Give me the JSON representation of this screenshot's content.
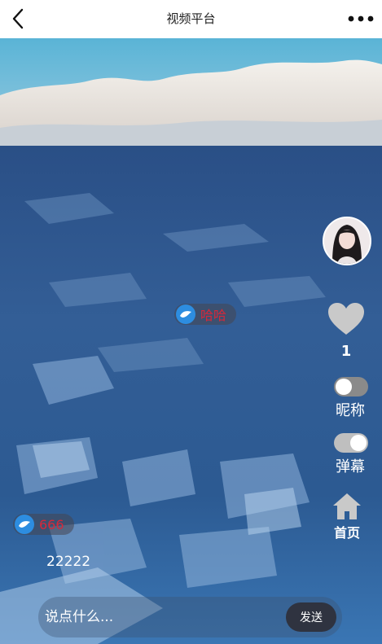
{
  "header": {
    "title": "视频平台",
    "back_icon": "chevron-left-icon",
    "more_icon": "more-horizontal-icon"
  },
  "side": {
    "like_count": "1",
    "nickname_label": "昵称",
    "nickname_toggle": "off",
    "danmaku_label": "弹幕",
    "danmaku_toggle": "on",
    "home_label": "首页"
  },
  "danmaku": [
    {
      "text": "哈哈"
    },
    {
      "text": "666"
    }
  ],
  "comment": {
    "text": "22222"
  },
  "input": {
    "placeholder": "说点什么...",
    "send_label": "发送"
  },
  "colors": {
    "danmaku_text": "#d6283a",
    "send_bg": "#2f3340",
    "danmaku_icon": "#2d8de0"
  }
}
